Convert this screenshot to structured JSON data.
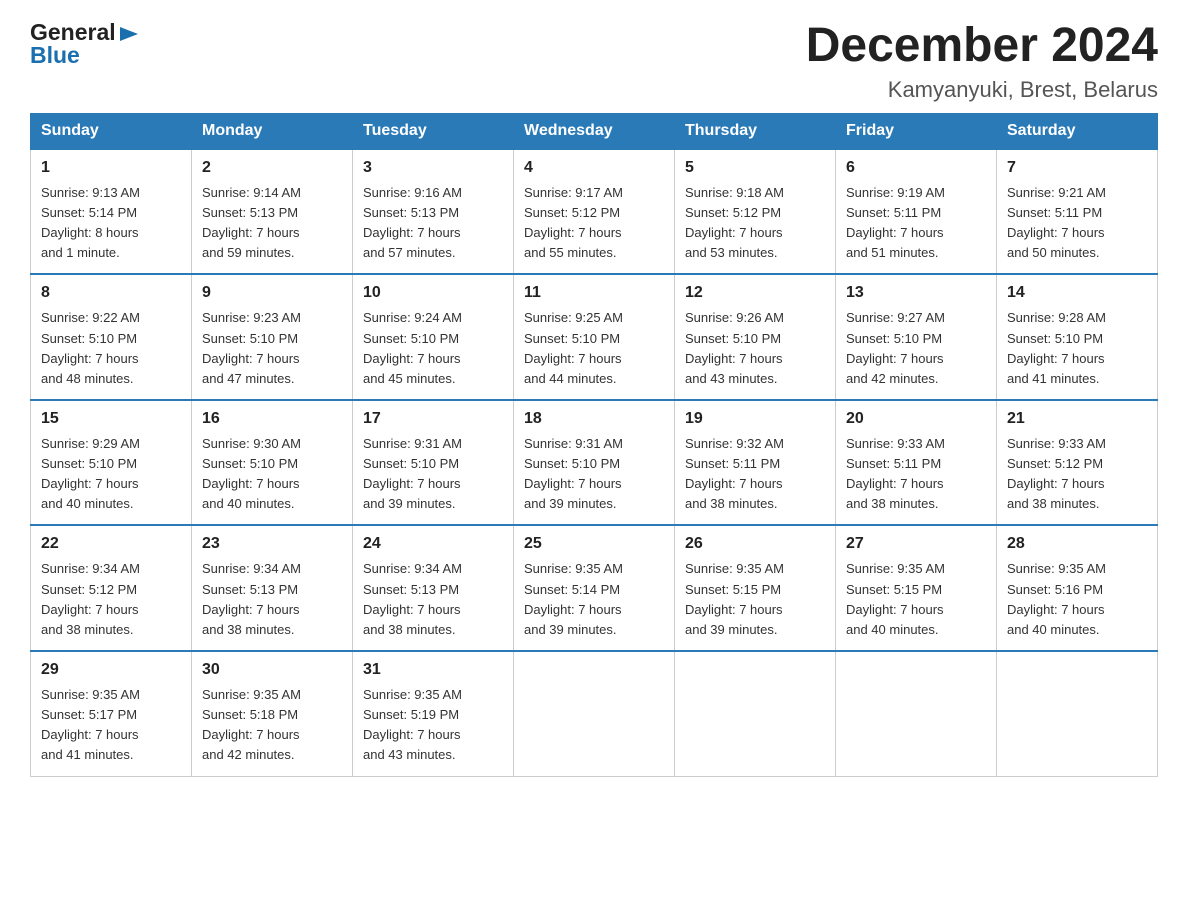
{
  "logo": {
    "general": "General",
    "arrow": "▶",
    "blue": "Blue"
  },
  "title": "December 2024",
  "subtitle": "Kamyanyuki, Brest, Belarus",
  "days_of_week": [
    "Sunday",
    "Monday",
    "Tuesday",
    "Wednesday",
    "Thursday",
    "Friday",
    "Saturday"
  ],
  "weeks": [
    [
      {
        "num": "1",
        "info": "Sunrise: 9:13 AM\nSunset: 5:14 PM\nDaylight: 8 hours\nand 1 minute."
      },
      {
        "num": "2",
        "info": "Sunrise: 9:14 AM\nSunset: 5:13 PM\nDaylight: 7 hours\nand 59 minutes."
      },
      {
        "num": "3",
        "info": "Sunrise: 9:16 AM\nSunset: 5:13 PM\nDaylight: 7 hours\nand 57 minutes."
      },
      {
        "num": "4",
        "info": "Sunrise: 9:17 AM\nSunset: 5:12 PM\nDaylight: 7 hours\nand 55 minutes."
      },
      {
        "num": "5",
        "info": "Sunrise: 9:18 AM\nSunset: 5:12 PM\nDaylight: 7 hours\nand 53 minutes."
      },
      {
        "num": "6",
        "info": "Sunrise: 9:19 AM\nSunset: 5:11 PM\nDaylight: 7 hours\nand 51 minutes."
      },
      {
        "num": "7",
        "info": "Sunrise: 9:21 AM\nSunset: 5:11 PM\nDaylight: 7 hours\nand 50 minutes."
      }
    ],
    [
      {
        "num": "8",
        "info": "Sunrise: 9:22 AM\nSunset: 5:10 PM\nDaylight: 7 hours\nand 48 minutes."
      },
      {
        "num": "9",
        "info": "Sunrise: 9:23 AM\nSunset: 5:10 PM\nDaylight: 7 hours\nand 47 minutes."
      },
      {
        "num": "10",
        "info": "Sunrise: 9:24 AM\nSunset: 5:10 PM\nDaylight: 7 hours\nand 45 minutes."
      },
      {
        "num": "11",
        "info": "Sunrise: 9:25 AM\nSunset: 5:10 PM\nDaylight: 7 hours\nand 44 minutes."
      },
      {
        "num": "12",
        "info": "Sunrise: 9:26 AM\nSunset: 5:10 PM\nDaylight: 7 hours\nand 43 minutes."
      },
      {
        "num": "13",
        "info": "Sunrise: 9:27 AM\nSunset: 5:10 PM\nDaylight: 7 hours\nand 42 minutes."
      },
      {
        "num": "14",
        "info": "Sunrise: 9:28 AM\nSunset: 5:10 PM\nDaylight: 7 hours\nand 41 minutes."
      }
    ],
    [
      {
        "num": "15",
        "info": "Sunrise: 9:29 AM\nSunset: 5:10 PM\nDaylight: 7 hours\nand 40 minutes."
      },
      {
        "num": "16",
        "info": "Sunrise: 9:30 AM\nSunset: 5:10 PM\nDaylight: 7 hours\nand 40 minutes."
      },
      {
        "num": "17",
        "info": "Sunrise: 9:31 AM\nSunset: 5:10 PM\nDaylight: 7 hours\nand 39 minutes."
      },
      {
        "num": "18",
        "info": "Sunrise: 9:31 AM\nSunset: 5:10 PM\nDaylight: 7 hours\nand 39 minutes."
      },
      {
        "num": "19",
        "info": "Sunrise: 9:32 AM\nSunset: 5:11 PM\nDaylight: 7 hours\nand 38 minutes."
      },
      {
        "num": "20",
        "info": "Sunrise: 9:33 AM\nSunset: 5:11 PM\nDaylight: 7 hours\nand 38 minutes."
      },
      {
        "num": "21",
        "info": "Sunrise: 9:33 AM\nSunset: 5:12 PM\nDaylight: 7 hours\nand 38 minutes."
      }
    ],
    [
      {
        "num": "22",
        "info": "Sunrise: 9:34 AM\nSunset: 5:12 PM\nDaylight: 7 hours\nand 38 minutes."
      },
      {
        "num": "23",
        "info": "Sunrise: 9:34 AM\nSunset: 5:13 PM\nDaylight: 7 hours\nand 38 minutes."
      },
      {
        "num": "24",
        "info": "Sunrise: 9:34 AM\nSunset: 5:13 PM\nDaylight: 7 hours\nand 38 minutes."
      },
      {
        "num": "25",
        "info": "Sunrise: 9:35 AM\nSunset: 5:14 PM\nDaylight: 7 hours\nand 39 minutes."
      },
      {
        "num": "26",
        "info": "Sunrise: 9:35 AM\nSunset: 5:15 PM\nDaylight: 7 hours\nand 39 minutes."
      },
      {
        "num": "27",
        "info": "Sunrise: 9:35 AM\nSunset: 5:15 PM\nDaylight: 7 hours\nand 40 minutes."
      },
      {
        "num": "28",
        "info": "Sunrise: 9:35 AM\nSunset: 5:16 PM\nDaylight: 7 hours\nand 40 minutes."
      }
    ],
    [
      {
        "num": "29",
        "info": "Sunrise: 9:35 AM\nSunset: 5:17 PM\nDaylight: 7 hours\nand 41 minutes."
      },
      {
        "num": "30",
        "info": "Sunrise: 9:35 AM\nSunset: 5:18 PM\nDaylight: 7 hours\nand 42 minutes."
      },
      {
        "num": "31",
        "info": "Sunrise: 9:35 AM\nSunset: 5:19 PM\nDaylight: 7 hours\nand 43 minutes."
      },
      null,
      null,
      null,
      null
    ]
  ]
}
